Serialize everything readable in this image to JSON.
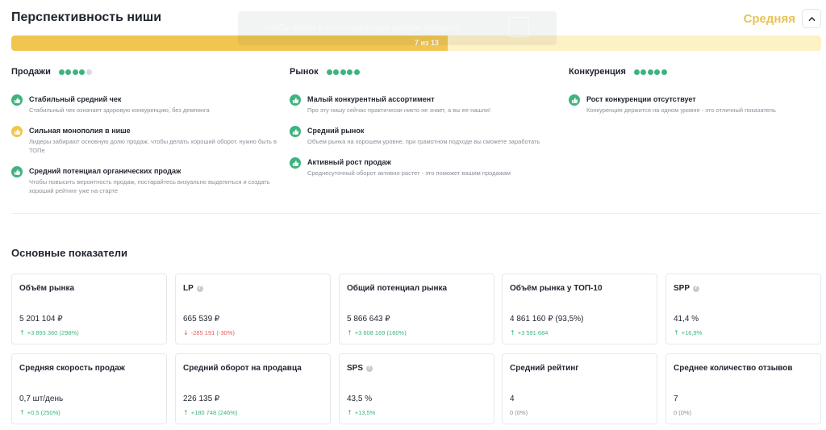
{
  "header": {
    "title": "Перспективность ниши",
    "rating": "Средняя"
  },
  "tooltip": {
    "text": "Чтобы войти в полноэкранный режим, нажмите"
  },
  "progress": {
    "label": "7 из 13",
    "value": 7,
    "max": 13
  },
  "columns": [
    {
      "title": "Продажи",
      "score": 4,
      "max": 5,
      "factors": [
        {
          "status": "good",
          "title": "Стабильный средний чек",
          "desc": "Стабильный чек означает здоровую конкуренцию, без демпинга"
        },
        {
          "status": "warn",
          "title": "Сильная монополия в нише",
          "desc": "Лидеры забирают основную долю продаж, чтобы делать хороший оборот, нужно быть в ТОПе"
        },
        {
          "status": "good",
          "title": "Средний потенциал органических продаж",
          "desc": "Чтобы повысить вероятность продаж, постарайтесь визуально выделиться и создать хороший рейтинг уже на старте"
        }
      ]
    },
    {
      "title": "Рынок",
      "score": 5,
      "max": 5,
      "factors": [
        {
          "status": "good",
          "title": "Малый конкурентный ассортимент",
          "desc": "Про эту нишу сейчас практически никто не знает, а вы ее нашли!"
        },
        {
          "status": "good",
          "title": "Средний рынок",
          "desc": "Объем рынка на хорошем уровне, при грамотном подходе вы сможете заработать"
        },
        {
          "status": "good",
          "title": "Активный рост продаж",
          "desc": "Среднесуточный оборот активно растет - это поможет вашим продажам"
        }
      ]
    },
    {
      "title": "Конкуренция",
      "score": 5,
      "max": 5,
      "factors": [
        {
          "status": "good",
          "title": "Рост конкуренции отсутствует",
          "desc": "Конкуренция держится на одном уровне - это отличный показатель"
        }
      ]
    }
  ],
  "metrics_section": {
    "title": "Основные показатели"
  },
  "metrics": [
    {
      "label": "Объём рынка",
      "info": false,
      "value": "5 201 104 ₽",
      "delta": "+3 893 360 (298%)",
      "trend": "up"
    },
    {
      "label": "LP",
      "info": true,
      "value": "665 539 ₽",
      "delta": "-285 191 (-30%)",
      "trend": "down"
    },
    {
      "label": "Общий потенциал рынка",
      "info": false,
      "value": "5 866 643 ₽",
      "delta": "+3 608 169 (160%)",
      "trend": "up"
    },
    {
      "label": "Объём рынка у ТОП-10",
      "info": false,
      "value": "4 861 160 ₽  (93,5%)",
      "delta": "+3 591 684",
      "trend": "up"
    },
    {
      "label": "SPP",
      "info": true,
      "value": "41,4 %",
      "delta": "+16,9%",
      "trend": "up"
    },
    {
      "label": "Средняя скорость продаж",
      "info": false,
      "value": "0,7 шт/день",
      "delta": "+0,5 (250%)",
      "trend": "up"
    },
    {
      "label": "Средний оборот на продавца",
      "info": false,
      "value": "226 135 ₽",
      "delta": "+180 748 (246%)",
      "trend": "up"
    },
    {
      "label": "SPS",
      "info": true,
      "value": "43,5 %",
      "delta": "+13,5%",
      "trend": "up"
    },
    {
      "label": "Средний рейтинг",
      "info": false,
      "value": "4",
      "delta": "0 (0%)",
      "trend": "neutral"
    },
    {
      "label": "Среднее количество отзывов",
      "info": false,
      "value": "7",
      "delta": "0 (0%)",
      "trend": "neutral"
    }
  ],
  "colors": {
    "accent_yellow": "#f0c550",
    "rating_text": "#e8c35a",
    "positive": "#3fb37f",
    "negative": "#e35d5d",
    "neutral": "#8a8f99"
  }
}
